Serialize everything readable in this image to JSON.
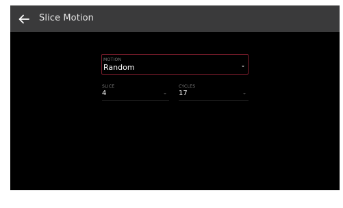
{
  "header": {
    "back_icon": "arrow-left-icon",
    "title": "Slice Motion"
  },
  "motion": {
    "label": "MOTION",
    "value": "Random",
    "arrow_icon": "caret-down-icon"
  },
  "slice": {
    "label": "SLICE",
    "value": "4"
  },
  "cycles": {
    "label": "CYCLES",
    "value": "17"
  },
  "colors": {
    "header_bg": "#3a3a3b",
    "app_bg": "#000000",
    "focus_border": "#7e1e2d",
    "label": "#7d7d7d",
    "value": "#ffffff"
  }
}
